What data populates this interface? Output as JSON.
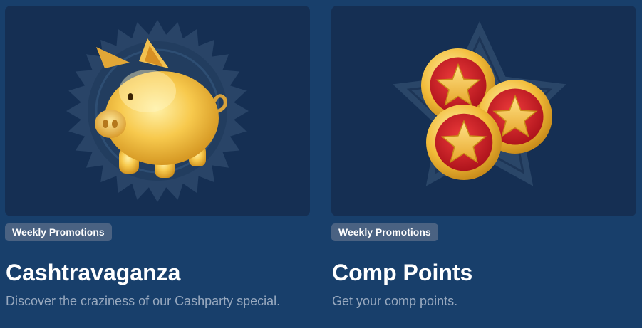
{
  "cards": [
    {
      "badge": "Weekly Promotions",
      "title": "Cashtravaganza",
      "description": "Discover the craziness of our Cashparty special.",
      "image_icon": "piggy-bank-icon"
    },
    {
      "badge": "Weekly Promotions",
      "title": "Comp Points",
      "description": "Get your comp points.",
      "image_icon": "star-coins-icon"
    }
  ],
  "colors": {
    "page_background": "#183f6b",
    "card_image_background": "#152f53",
    "badge_background": "#4a6282",
    "title_text": "#ffffff",
    "description_text": "#98a9bf",
    "coin_red": "#c8141e",
    "gold": "#f5c04a"
  }
}
